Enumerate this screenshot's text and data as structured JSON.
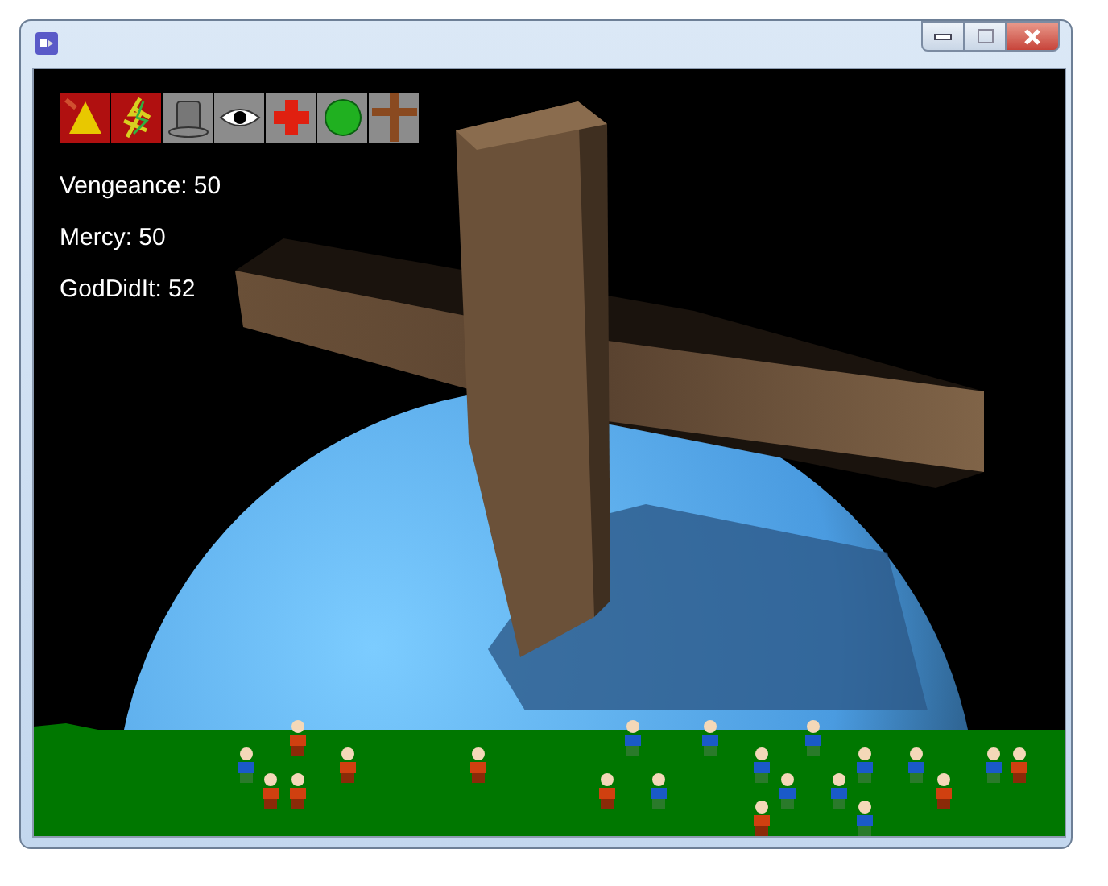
{
  "stats": [
    {
      "label": "Vengeance: 50"
    },
    {
      "label": "Mercy: 50"
    },
    {
      "label": "GodDidIt: 52"
    }
  ]
}
